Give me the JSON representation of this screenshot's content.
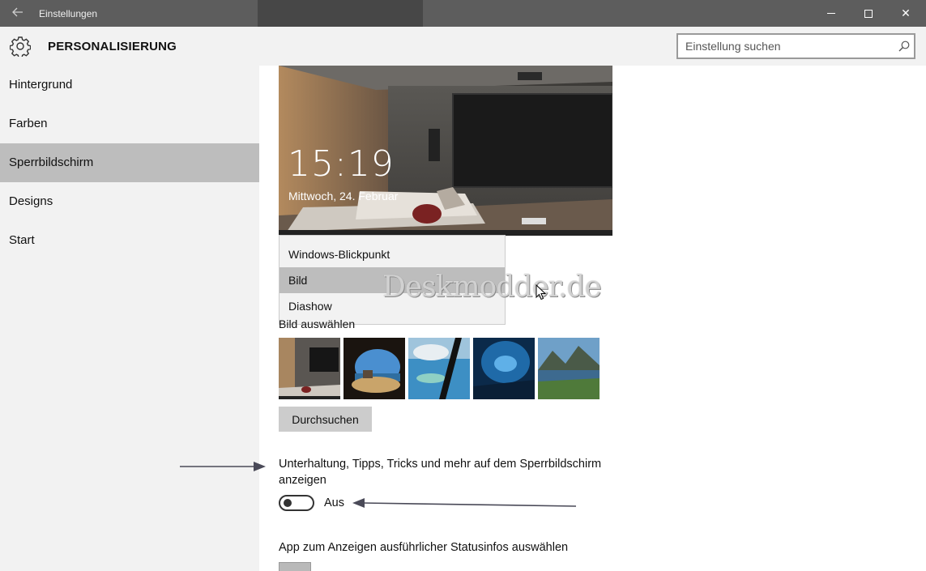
{
  "window": {
    "title": "Einstellungen",
    "back_icon": "back-arrow-icon",
    "minimize_icon": "minimize-icon",
    "maximize_icon": "maximize-icon",
    "close_icon": "close-icon",
    "close_glyph": "✕"
  },
  "header": {
    "icon": "gear-icon",
    "title": "PERSONALISIERUNG",
    "search": {
      "placeholder": "Einstellung suchen",
      "value": "",
      "icon": "search-icon"
    }
  },
  "sidebar": {
    "items": [
      {
        "label": "Hintergrund",
        "active": false
      },
      {
        "label": "Farben",
        "active": false
      },
      {
        "label": "Sperrbildschirm",
        "active": true
      },
      {
        "label": "Designs",
        "active": false
      },
      {
        "label": "Start",
        "active": false
      }
    ]
  },
  "preview": {
    "time": "15:19",
    "date": "Mittwoch, 24. Februar"
  },
  "background_dropdown": {
    "options": [
      "Windows-Blickpunkt",
      "Bild",
      "Diashow"
    ],
    "selected": "Bild"
  },
  "watermark": "Deskmodder.de",
  "choose_picture": {
    "label": "Bild auswählen",
    "thumbnails": [
      "living-room",
      "beach-cave",
      "aerial-coast",
      "ice-cave",
      "mountain-lake"
    ]
  },
  "browse_button": "Durchsuchen",
  "tips": {
    "label": "Unterhaltung, Tipps, Tricks und mehr auf dem Sperrbildschirm anzeigen",
    "state_label": "Aus",
    "on": false
  },
  "status_app": {
    "label": "App zum Anzeigen ausführlicher Statusinfos auswählen"
  },
  "colors": {
    "titlebar": "#5d5d5d",
    "panel": "#f2f2f2",
    "selected": "#bdbdbd",
    "annotation_arrow": "#4a4a58"
  }
}
